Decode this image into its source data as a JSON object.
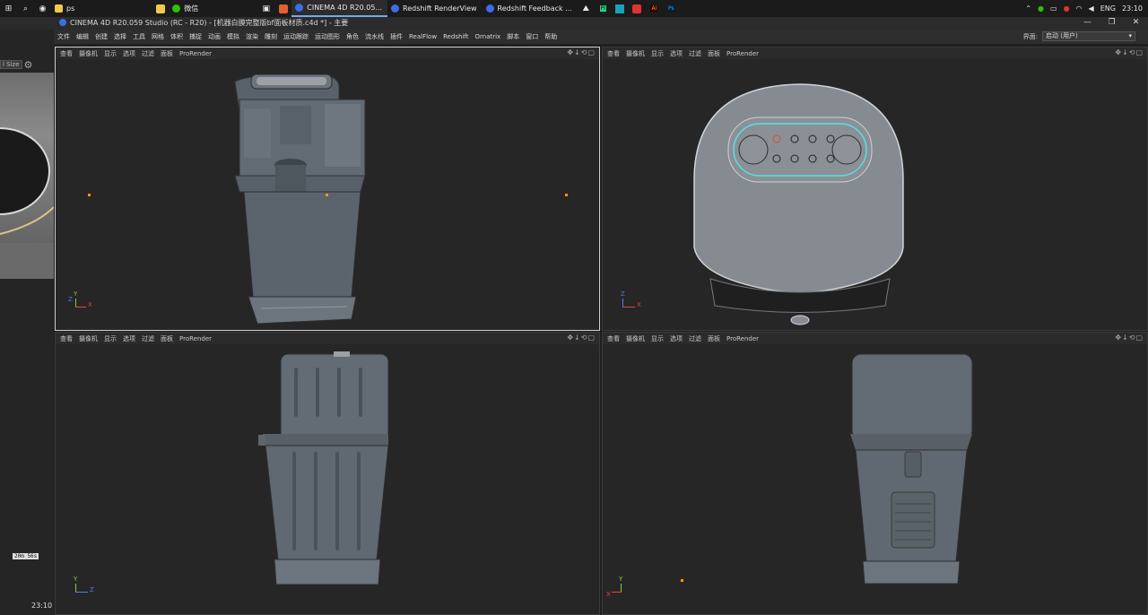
{
  "taskbar": {
    "tasks": [
      {
        "label": "ps",
        "color": "#f2c94c"
      },
      {
        "label": "微信",
        "color": "#2dc100"
      },
      {
        "label": "CINEMA 4D R20.05...",
        "color": "#3b6ee6"
      },
      {
        "label": "Redshift RenderView",
        "color": "#3b6ee6"
      },
      {
        "label": "Redshift Feedback ...",
        "color": "#3b6ee6"
      }
    ],
    "lang": "ENG",
    "time": "23:10"
  },
  "window": {
    "title": "CINEMA 4D R20.059 Studio (RC - R20) - [机器白膜完整版bf面板材质.c4d *] - 主要"
  },
  "menubar": {
    "items": [
      "文件",
      "编辑",
      "创建",
      "选择",
      "工具",
      "网格",
      "体积",
      "捕捉",
      "动画",
      "模拟",
      "渲染",
      "雕刻",
      "运动跟踪",
      "运动图形",
      "角色",
      "流水线",
      "插件",
      "RealFlow",
      "Redshift",
      "Ornatrix",
      "脚本",
      "窗口",
      "帮助"
    ],
    "layout_label": "界面:",
    "layout_value": "启动 (用户)"
  },
  "leftpanel": {
    "size_label": "l Size",
    "timer": "20m 56s",
    "clock": "23:10"
  },
  "viewports": {
    "top_left": {
      "menu": [
        "查看",
        "摄像机",
        "显示",
        "选项",
        "过滤",
        "面板",
        "ProRender"
      ],
      "axes": [
        "Y",
        "X",
        "Z"
      ]
    },
    "top_right": {
      "menu": [
        "查看",
        "摄像机",
        "显示",
        "选项",
        "过滤",
        "面板",
        "ProRender"
      ],
      "axes": [
        "Z",
        "X"
      ]
    },
    "bottom_left": {
      "menu": [
        "查看",
        "摄像机",
        "显示",
        "选项",
        "过滤",
        "面板",
        "ProRender"
      ],
      "axes": [
        "Y",
        "Z"
      ]
    },
    "bottom_right": {
      "menu": [
        "查看",
        "摄像机",
        "显示",
        "选项",
        "过滤",
        "面板",
        "ProRender"
      ],
      "axes": [
        "Y",
        "X"
      ]
    }
  },
  "colors": {
    "axis_x": "#e0473e",
    "axis_y": "#7fd13b",
    "axis_z": "#4f7de6",
    "pivot": "#ff9a00",
    "model": "#5d6670"
  }
}
